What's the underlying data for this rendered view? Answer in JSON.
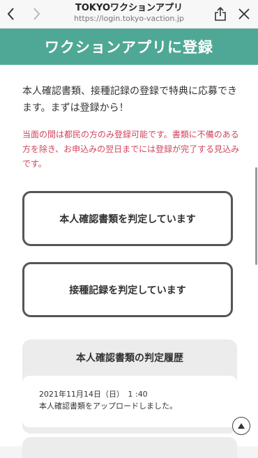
{
  "browser": {
    "page_name": "TOKYOワクションアプリ",
    "url": "https://login.tokyo-vaction.jp",
    "icons": {
      "back": "chevron-left-icon",
      "forward": "chevron-right-icon",
      "share": "share-icon",
      "close": "close-icon"
    }
  },
  "header": {
    "title": "ワクションアプリに登録"
  },
  "intro": "本人確認書類、接種記録の登録で特典に応募できます。まずは登録から！",
  "notice": "当面の間は都民の方のみ登録可能です。書類に不備のある方を除き、お申込みの翌日までには登録が完了する見込みです。",
  "buttons": {
    "id_status": "本人確認書類を判定しています",
    "vax_status": "接種記録を判定しています"
  },
  "history": {
    "title": "本人確認書類の判定履歴",
    "entries": [
      {
        "date": "2021年11月14日（日）　1 :40",
        "text": "本人確認書類をアップロードしました。"
      }
    ]
  },
  "colors": {
    "header_bg": "#4fa895",
    "notice_text": "#d0455e",
    "border": "#555555"
  }
}
